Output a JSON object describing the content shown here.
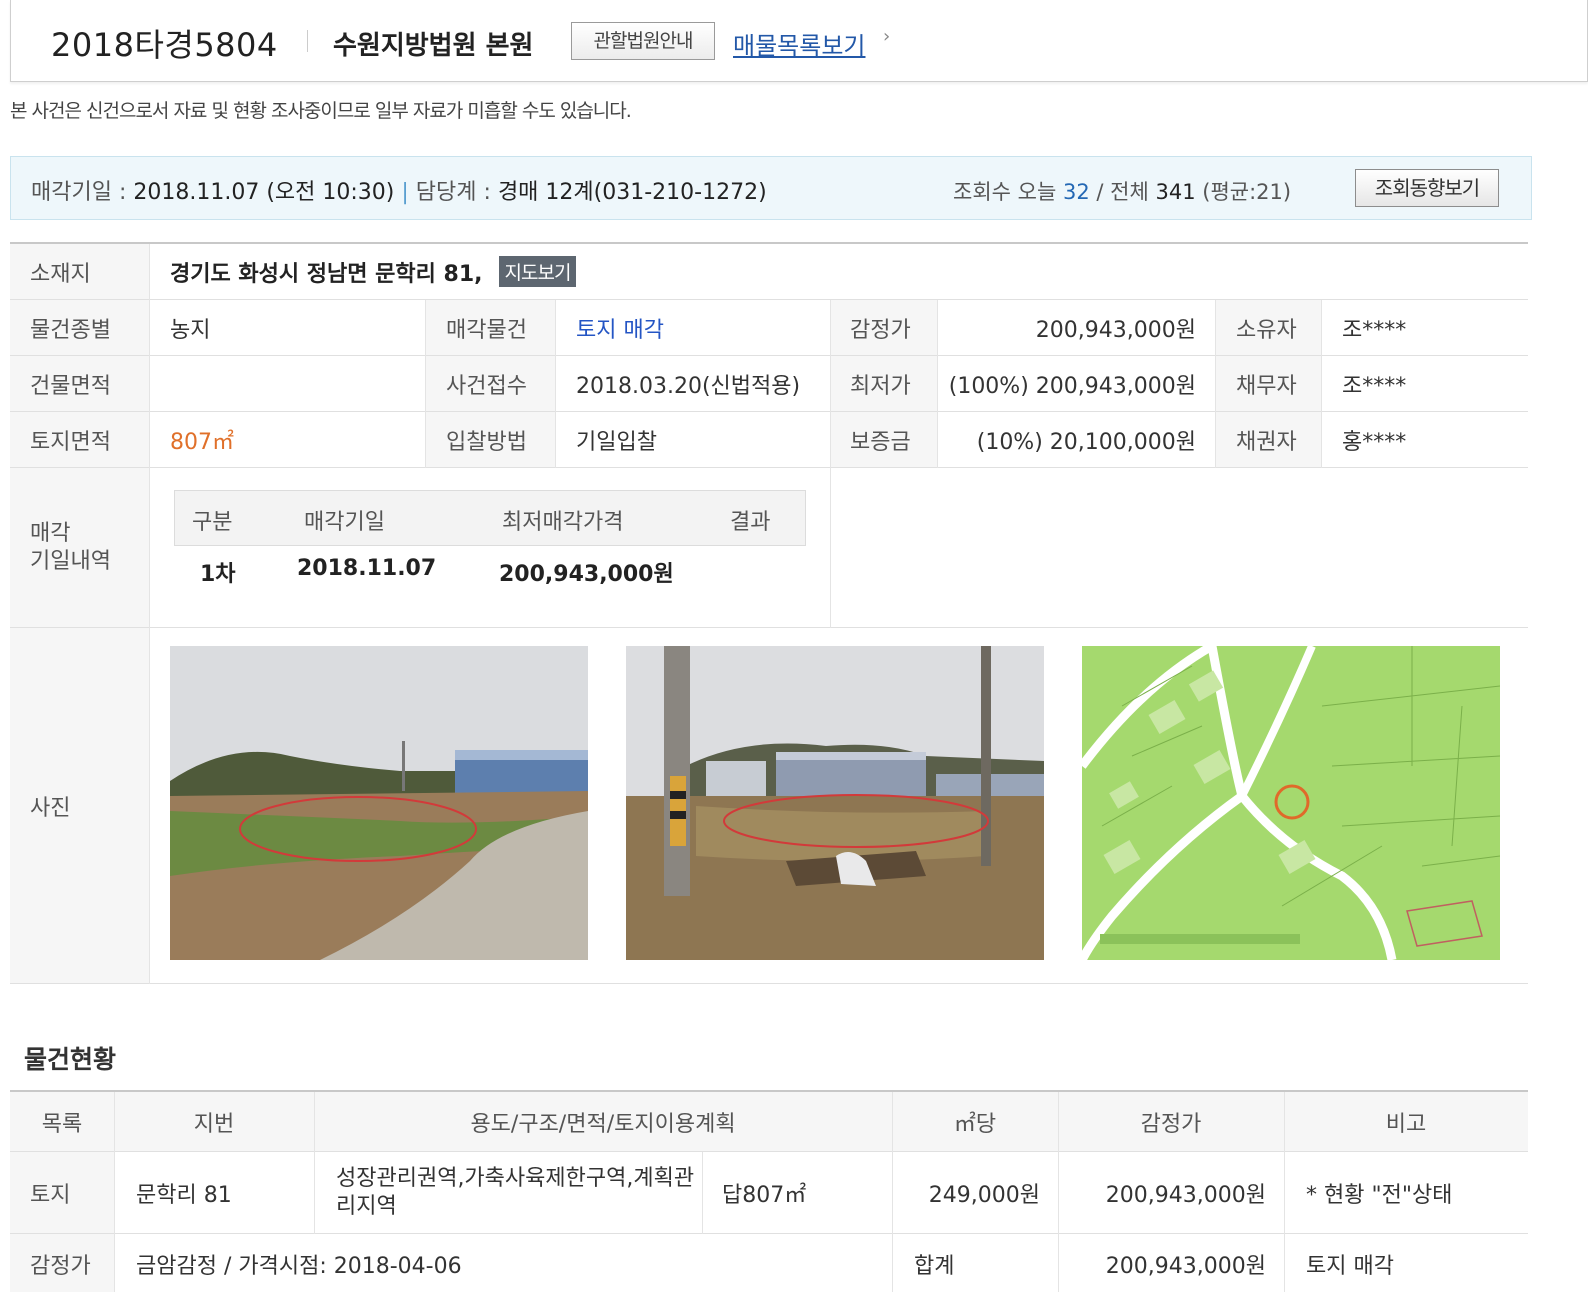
{
  "header": {
    "case_number": "2018타경5804",
    "court": "수원지방법원 본원",
    "court_info_button": "관할법원안내",
    "list_link": "매물목록보기",
    "list_arrow": "›"
  },
  "notice": "본 사건은 신건으로서 자료 및 현황 조사중이므로 일부 자료가 미흡할 수도 있습니다.",
  "infobar": {
    "sale_date_label": "매각기일 :",
    "sale_date_value": "2018.11.07 (오전 10:30)",
    "separator": "|",
    "dept_label": "담당계 :",
    "dept_value": "경매 12계(031-210-1272)",
    "views_label": "조회수 오늘",
    "views_today": "32",
    "views_total_label": "/ 전체",
    "views_total": "341",
    "views_avg": "(평균:21)",
    "trend_button": "조회동향보기"
  },
  "details": {
    "location_label": "소재지",
    "location_value": "경기도 화성시 정남면 문학리 81,",
    "map_button": "지도보기",
    "item_type_label": "물건종별",
    "item_type_value": "농지",
    "sale_item_label": "매각물건",
    "sale_item_value": "토지 매각",
    "appraisal_label": "감정가",
    "appraisal_value": "200,943,000원",
    "owner_label": "소유자",
    "owner_value": "조****",
    "building_area_label": "건물면적",
    "building_area_value": "",
    "case_received_label": "사건접수",
    "case_received_value": "2018.03.20(신법적용)",
    "min_price_label": "최저가",
    "min_price_value": "(100%) 200,943,000원",
    "debtor_label": "채무자",
    "debtor_value": "조****",
    "land_area_label": "토지면적",
    "land_area_value": "807㎡",
    "bid_method_label": "입찰방법",
    "bid_method_value": "기일입찰",
    "deposit_label": "보증금",
    "deposit_value": "(10%) 20,100,000원",
    "creditor_label": "채권자",
    "creditor_value": "홍****",
    "history_label_1": "매각",
    "history_label_2": "기일내역",
    "photos_label": "사진"
  },
  "sale_history": {
    "headers": [
      "구분",
      "매각기일",
      "최저매각가격",
      "결과"
    ],
    "rows": [
      {
        "round": "1차",
        "date": "2018.11.07",
        "price": "200,943,000원",
        "result": ""
      }
    ]
  },
  "photos": [
    {
      "icon": "land-photo-1"
    },
    {
      "icon": "land-photo-2"
    },
    {
      "icon": "cadastral-map"
    }
  ],
  "status": {
    "title": "물건현황",
    "headers": [
      "목록",
      "지번",
      "용도/구조/면적/토지이용계획",
      "㎡당",
      "감정가",
      "비고"
    ],
    "row": {
      "category": "토지",
      "lot": "문학리 81",
      "zoning": "성장관리권역,가축사육제한구역,계획관리지역",
      "area": "답807㎡",
      "per_m2": "249,000원",
      "appraisal": "200,943,000원",
      "note": "* 현황 \"전\"상태"
    },
    "footer": {
      "label": "감정가",
      "appraiser": "금암감정 / 가격시점: 2018-04-06",
      "total_label": "합계",
      "total_value": "200,943,000원",
      "total_note": "토지 매각"
    }
  }
}
